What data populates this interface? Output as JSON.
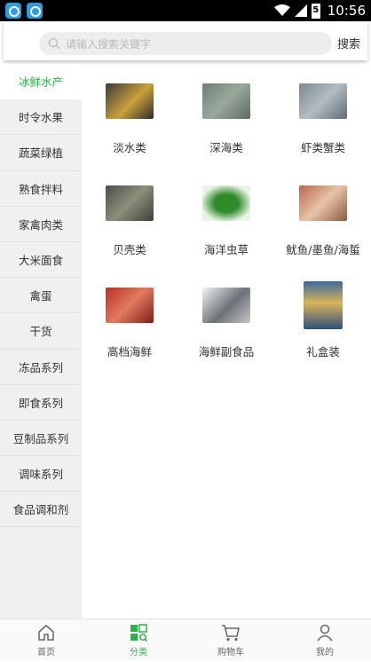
{
  "status_bar": {
    "time": "10:56",
    "battery": "5"
  },
  "search": {
    "placeholder": "请输入搜索关键字",
    "button_label": "搜索"
  },
  "sidebar": {
    "items": [
      {
        "label": "冰鲜水产",
        "active": true
      },
      {
        "label": "时令水果"
      },
      {
        "label": "蔬菜绿植"
      },
      {
        "label": "熟食拌料"
      },
      {
        "label": "家禽肉类"
      },
      {
        "label": "大米面食"
      },
      {
        "label": "禽蛋"
      },
      {
        "label": "干货"
      },
      {
        "label": "冻品系列"
      },
      {
        "label": "即食系列"
      },
      {
        "label": "豆制品系列"
      },
      {
        "label": "调味系列"
      },
      {
        "label": "食品调和剂"
      }
    ]
  },
  "categories": [
    {
      "label": "淡水类"
    },
    {
      "label": "深海类"
    },
    {
      "label": "虾类蟹类"
    },
    {
      "label": "贝壳类"
    },
    {
      "label": "海洋虫草"
    },
    {
      "label": "鱿鱼/墨鱼/海蜇"
    },
    {
      "label": "高档海鲜"
    },
    {
      "label": "海鲜副食品"
    },
    {
      "label": "礼盒装"
    }
  ],
  "tabs": [
    {
      "label": "首页",
      "icon": "home-icon"
    },
    {
      "label": "分类",
      "icon": "category-icon",
      "active": true
    },
    {
      "label": "购物车",
      "icon": "cart-icon"
    },
    {
      "label": "我的",
      "icon": "profile-icon"
    }
  ],
  "colors": {
    "accent": "#2fb14a",
    "sidebar_bg": "#f0f0f0",
    "status_bar_bg": "#000000"
  }
}
